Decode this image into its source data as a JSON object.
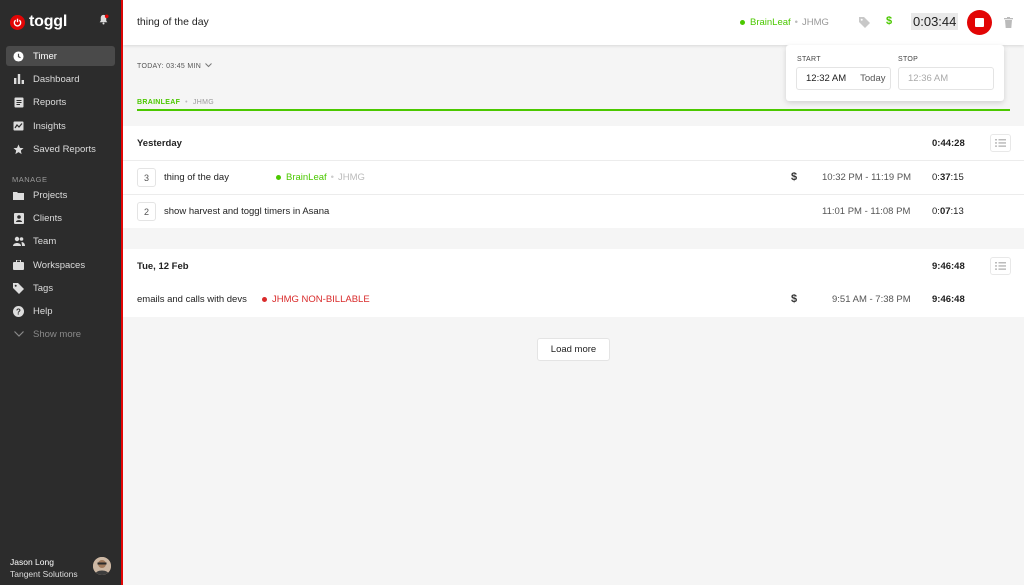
{
  "app": {
    "logo_text": "toggl"
  },
  "colors": {
    "brand": "#e20505",
    "project_green": "#4bc800",
    "non_billable_red": "#d92b2b"
  },
  "sidebar": {
    "items": [
      {
        "label": "Timer",
        "icon": "clock-icon",
        "active": true
      },
      {
        "label": "Dashboard",
        "icon": "bar-chart-icon"
      },
      {
        "label": "Reports",
        "icon": "document-icon"
      },
      {
        "label": "Insights",
        "icon": "insights-icon"
      },
      {
        "label": "Saved Reports",
        "icon": "star-icon"
      }
    ],
    "manage_label": "MANAGE",
    "manage_items": [
      {
        "label": "Projects",
        "icon": "folder-icon"
      },
      {
        "label": "Clients",
        "icon": "contact-icon"
      },
      {
        "label": "Team",
        "icon": "team-icon"
      },
      {
        "label": "Workspaces",
        "icon": "briefcase-icon"
      },
      {
        "label": "Tags",
        "icon": "tag-icon"
      },
      {
        "label": "Help",
        "icon": "help-icon"
      },
      {
        "label": "Show more",
        "icon": "chevron-down-icon"
      }
    ],
    "user": {
      "name": "Jason Long",
      "org": "Tangent Solutions"
    }
  },
  "timer": {
    "description": "thing of the day",
    "project": "BrainLeaf",
    "client": "JHMG",
    "sep": "•",
    "billable_symbol": "$",
    "duration": "0:03:44"
  },
  "popup": {
    "start_label": "START",
    "start_time": "12:32 AM",
    "start_day": "Today",
    "stop_label": "STOP",
    "stop_time": "12:36 AM"
  },
  "summary": {
    "today_label": "TODAY: 03:45 MIN",
    "project": "BRAINLEAF",
    "client": "JHMG"
  },
  "groups": [
    {
      "title": "Yesterday",
      "total": "0:44:28",
      "entries": [
        {
          "count": "3",
          "title": "thing of the day",
          "project": "BrainLeaf",
          "client": "JHMG",
          "billable": "$",
          "range": "10:32 PM - 11:19 PM",
          "dur_prefix": "0:",
          "dur_bold": "37",
          "dur_suffix": ":15"
        },
        {
          "count": "2",
          "title": "show harvest and toggl timers in Asana",
          "range": "11:01 PM - 11:08 PM",
          "dur_prefix": "0:",
          "dur_bold": "07",
          "dur_suffix": ":13"
        }
      ]
    },
    {
      "title": "Tue, 12 Feb",
      "total": "9:46:48",
      "entries": [
        {
          "title": "emails and calls with devs",
          "project": "JHMG NON-BILLABLE",
          "billable": "$",
          "range": "9:51 AM - 7:38 PM",
          "duration": "9:46:48"
        }
      ]
    }
  ],
  "load_more": "Load more"
}
